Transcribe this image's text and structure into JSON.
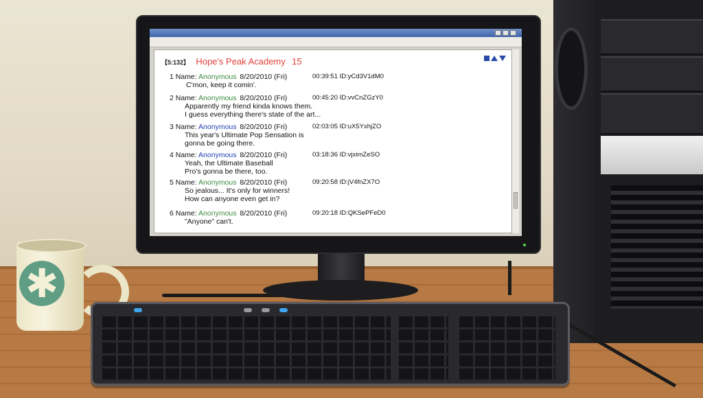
{
  "thread": {
    "count": "【5:132】",
    "title": "Hope's Peak Academy",
    "number": "15"
  },
  "posts": [
    {
      "num": "1",
      "label": "Name:",
      "name": "Anonymous",
      "name_color": "green",
      "date": "8/20/2010 (Fri)",
      "time_id": "00:39:51 ID:yCd3V1dM0",
      "lines": [
        "C'mon, keep it comin'."
      ]
    },
    {
      "num": "2",
      "label": "Name:",
      "name": "Anonymous",
      "name_color": "green",
      "date": "8/20/2010 (Fri)",
      "time_id": "00:45:20 ID:vvCnZGzY0",
      "lines": [
        "Apparently my friend kinda knows them.",
        "I guess everything there's state of the art..."
      ]
    },
    {
      "num": "3",
      "label": "Name:",
      "name": "Anonymous",
      "name_color": "blue",
      "date": "8/20/2010 (Fri)",
      "time_id": "02:03:05 ID:uX5YxhjZO",
      "lines": [
        "This year's Ultimate Pop Sensation is",
        "gonna be going there."
      ]
    },
    {
      "num": "4",
      "label": "Name:",
      "name": "Anonymous",
      "name_color": "blue",
      "date": "8/20/2010 (Fri)",
      "time_id": "03:18:36 ID:vjximZeSO",
      "lines": [
        "Yeah, the Ultimate Baseball",
        "Pro's gonna be there, too."
      ]
    },
    {
      "num": "5",
      "label": "Name:",
      "name": "Anonymous",
      "name_color": "green",
      "date": "8/20/2010 (Fri)",
      "time_id": "09:20:58 ID:jV4fnZX7O",
      "lines": [
        "So jealous... It's only for winners!",
        "How can anyone even get in?"
      ]
    },
    {
      "num": "6",
      "label": "Name:",
      "name": "Anonymous",
      "name_color": "green",
      "date": "8/20/2010 (Fri)",
      "time_id": "09:20:18 ID:QKSePFeD0",
      "lines": [
        "\"Anyone\" can't."
      ]
    }
  ],
  "colors": {
    "title": "#e0403a",
    "name_green": "#3d8a3f",
    "name_blue": "#1e3fb3",
    "nav_icon": "#2a4aa8",
    "power_led": "#58d84d"
  },
  "icons": {
    "nav_square": "square-icon",
    "nav_up": "arrow-up-icon",
    "nav_down": "arrow-down-icon",
    "mug_logo": "asterisk-icon"
  },
  "mug": {
    "logo_glyph": "✱"
  }
}
